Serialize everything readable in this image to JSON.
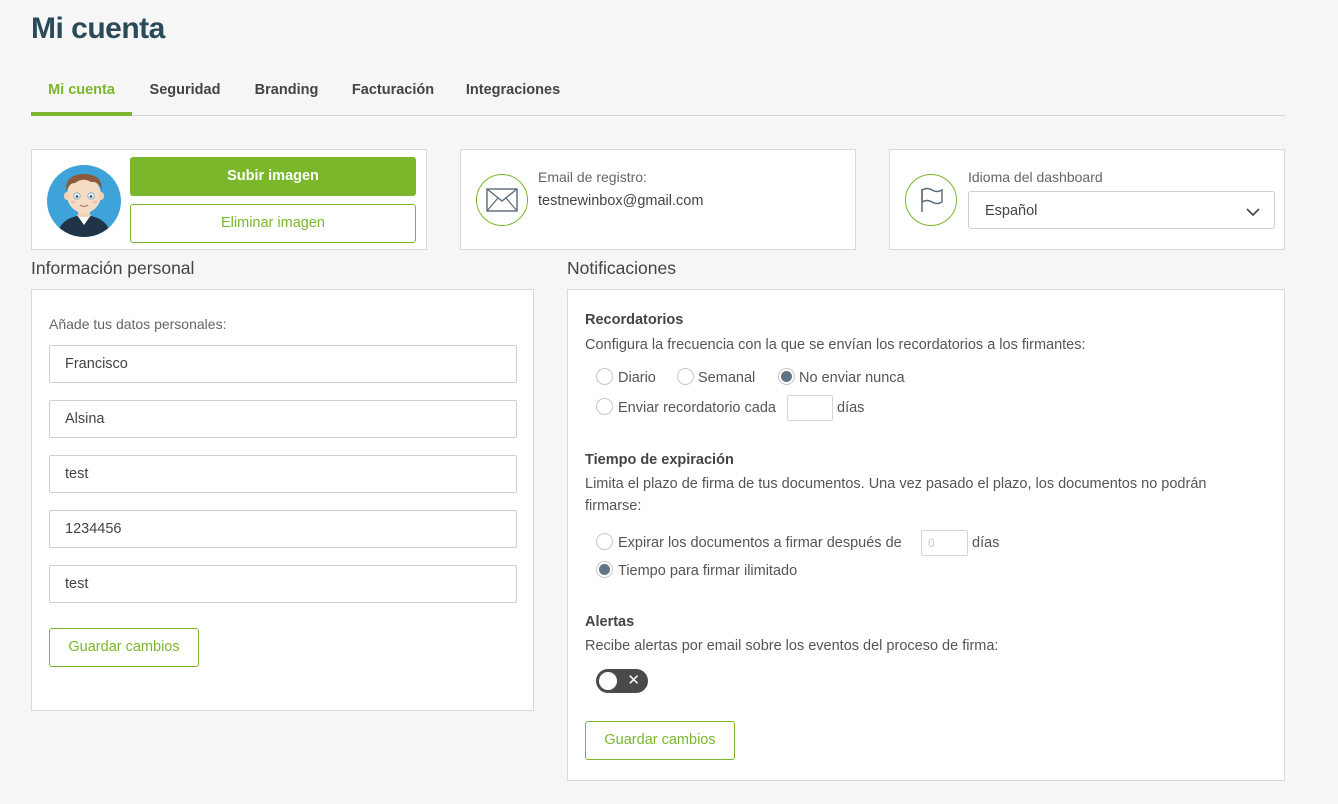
{
  "page": {
    "title": "Mi cuenta"
  },
  "tabs": [
    {
      "label": "Mi cuenta",
      "active": true
    },
    {
      "label": "Seguridad"
    },
    {
      "label": "Branding"
    },
    {
      "label": "Facturación"
    },
    {
      "label": "Integraciones"
    }
  ],
  "profile_image": {
    "upload_label": "Subir imagen",
    "delete_label": "Eliminar imagen"
  },
  "email_card": {
    "label": "Email de registro:",
    "value": "testnewinbox@gmail.com",
    "icon": "envelope-icon"
  },
  "language_card": {
    "label": "Idioma del dashboard",
    "selected": "Español",
    "icon": "flag-icon"
  },
  "personal": {
    "section_title": "Información personal",
    "intro": "Añade tus datos personales:",
    "fields": [
      "Francisco",
      "Alsina",
      "test",
      "1234456",
      "test"
    ],
    "save_label": "Guardar cambios"
  },
  "notifications": {
    "section_title": "Notificaciones",
    "reminders": {
      "title": "Recordatorios",
      "description": "Configura la frecuencia con la que se envían los recordatorios a los firmantes:",
      "options": [
        "Diario",
        "Semanal",
        "No enviar nunca"
      ],
      "selected": "No enviar nunca",
      "custom_prefix": "Enviar recordatorio cada",
      "custom_suffix": "días",
      "custom_value": ""
    },
    "expiration": {
      "title": "Tiempo de expiración",
      "description": "Limita el plazo de firma de tus documentos. Una vez pasado el plazo, los documentos no podrán firmarse:",
      "option_days_prefix": "Expirar los documentos a firmar después de",
      "option_days_suffix": "días",
      "days_placeholder": "0",
      "option_unlimited": "Tiempo para firmar ilimitado",
      "selected": "Tiempo para firmar ilimitado"
    },
    "alerts": {
      "title": "Alertas",
      "description": "Recibe alertas por email sobre los eventos del proceso de firma:",
      "enabled": false
    },
    "save_label": "Guardar cambios"
  },
  "colors": {
    "accent": "#7ab72a",
    "title": "#2a4a5a",
    "radio_checked": "#5f7486",
    "toggle_off": "#4a4a4a"
  }
}
